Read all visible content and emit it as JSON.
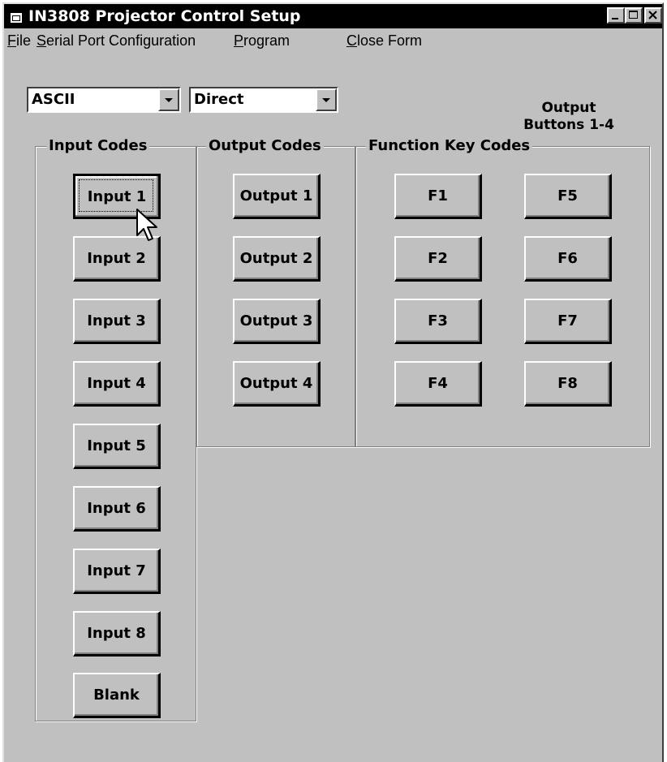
{
  "window": {
    "title": "IN3808 Projector Control Setup",
    "controls": [
      "minimize-icon",
      "maximize-icon",
      "close-icon"
    ]
  },
  "menu": {
    "items": [
      {
        "label": "File",
        "mnemonic": "F"
      },
      {
        "label": "Serial Port Configuration",
        "mnemonic": "S"
      },
      {
        "label": "Program",
        "mnemonic": "P"
      },
      {
        "label": "Close Form",
        "mnemonic": "C"
      }
    ]
  },
  "selectors": {
    "format": "ASCII",
    "mode": "Direct"
  },
  "output_note": {
    "line1": "Output",
    "line2": "Buttons 1-4"
  },
  "groups": {
    "input": {
      "label": "Input Codes",
      "buttons": [
        "Input 1",
        "Input 2",
        "Input 3",
        "Input 4",
        "Input 5",
        "Input 6",
        "Input 7",
        "Input 8",
        "Blank"
      ]
    },
    "output": {
      "label": "Output Codes",
      "buttons": [
        "Output 1",
        "Output 2",
        "Output 3",
        "Output 4"
      ]
    },
    "function": {
      "label": "Function Key Codes",
      "buttons": [
        "F1",
        "F2",
        "F3",
        "F4",
        "F5",
        "F6",
        "F7",
        "F8"
      ]
    }
  }
}
